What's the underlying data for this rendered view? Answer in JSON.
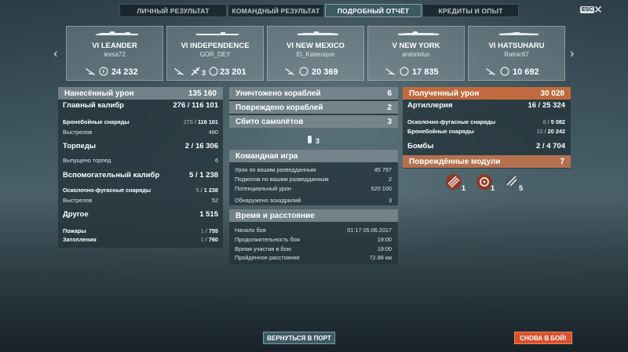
{
  "tabs": [
    {
      "label": "ЛИЧНЫЙ РЕЗУЛЬТАТ",
      "active": false
    },
    {
      "label": "КОМАНДНЫЙ РЕЗУЛЬТАТ",
      "active": false
    },
    {
      "label": "ПОДРОБНЫЙ ОТЧЁТ",
      "active": true
    },
    {
      "label": "КРЕДИТЫ И ОПЫТ",
      "active": false
    }
  ],
  "esc_label": "ESC",
  "close_glyph": "✕",
  "nav": {
    "prev": "‹",
    "next": "›"
  },
  "ships": [
    {
      "name": "VI LEANDER",
      "player": "lexsa72",
      "damage": "24 232",
      "extra_count": ""
    },
    {
      "name": "VI INDEPENDENCE",
      "player": "GOR_DEY",
      "damage": "23 201",
      "extra_count": "3"
    },
    {
      "name": "VI NEW MEXICO",
      "player": "El_Kateroque",
      "damage": "20 369",
      "extra_count": ""
    },
    {
      "name": "V NEW YORK",
      "player": "arahnidus",
      "damage": "17 835",
      "extra_count": ""
    },
    {
      "name": "VI HATSUHARU",
      "player": "Ratnic67",
      "damage": "10 692",
      "extra_count": ""
    }
  ],
  "left": {
    "header": {
      "label": "Нанесённый урон",
      "value": "135 160"
    },
    "main_caliber": {
      "label": "Главный калибр",
      "value_a": "276",
      "value_b": "116 101"
    },
    "ap_shells": {
      "label": "Бронебойные снаряды",
      "value_a": "276",
      "value_b": "116 101"
    },
    "shots": {
      "label": "Выстрелов",
      "value": "480"
    },
    "torpedoes": {
      "label": "Торпеды",
      "value_a": "2",
      "value_b": "16 306"
    },
    "torpedoes_fired": {
      "label": "Выпущено торпед",
      "value": "6"
    },
    "secondary": {
      "label": "Вспомогательный калибр",
      "value_a": "5",
      "value_b": "1 238"
    },
    "he_shells": {
      "label": "Осколочно-фугасные снаряды",
      "value_a": "5",
      "value_b": "1 238"
    },
    "secondary_shots": {
      "label": "Выстрелов",
      "value": "52"
    },
    "other": {
      "label": "Другое",
      "value": "1 515"
    },
    "fires": {
      "label": "Пожары",
      "value_a": "1",
      "value_b": "755"
    },
    "floods": {
      "label": "Затопления",
      "value_a": "1",
      "value_b": "760"
    }
  },
  "middle": {
    "destroyed": {
      "label": "Уничтожено кораблей",
      "value": "6"
    },
    "damaged": {
      "label": "Повреждено кораблей",
      "value": "2"
    },
    "planes": {
      "label": "Сбито самолётов",
      "value": "3"
    },
    "plane_count": "3",
    "team": {
      "header": "Командная игра",
      "rows": [
        {
          "label": "Урон по вашим разведданным",
          "value": "45 797"
        },
        {
          "label": "Поджогов по вашим разведданным",
          "value": "2"
        },
        {
          "label": "Потенциальный урон",
          "value": "520 100"
        },
        {
          "label": "Обнаружено эскадрилий",
          "value": "3"
        }
      ]
    },
    "time": {
      "header": "Время и расстояние",
      "rows": [
        {
          "label": "Начало боя",
          "value": "01:17  05.06.2017"
        },
        {
          "label": "Продолжительность боя",
          "value": "19:00"
        },
        {
          "label": "Время участия в бою",
          "value": "19:00"
        },
        {
          "label": "Пройденное расстояние",
          "value": "72.98 км"
        }
      ]
    }
  },
  "right": {
    "header": {
      "label": "Полученный урон",
      "value": "30 028"
    },
    "artillery": {
      "label": "Артиллерия",
      "value_a": "16",
      "value_b": "25 324"
    },
    "he_shells": {
      "label": "Осколочно-фугасные снаряды",
      "value_a": "6",
      "value_b": "5 082"
    },
    "ap_shells": {
      "label": "Бронебойные снаряды",
      "value_a": "10",
      "value_b": "20 242"
    },
    "bombs": {
      "label": "Бомбы",
      "value_a": "2",
      "value_b": "4 704"
    },
    "modules": {
      "label": "Повреждённые модули",
      "value": "7"
    },
    "module_icons": [
      {
        "name": "guns-module-icon",
        "count": "1"
      },
      {
        "name": "engine-module-icon",
        "count": "1"
      },
      {
        "name": "aa-module-icon",
        "count": "5"
      }
    ]
  },
  "buttons": {
    "port": "ВЕРНУТЬСЯ В ПОРТ",
    "battle": "СНОВА В БОЙ!"
  }
}
